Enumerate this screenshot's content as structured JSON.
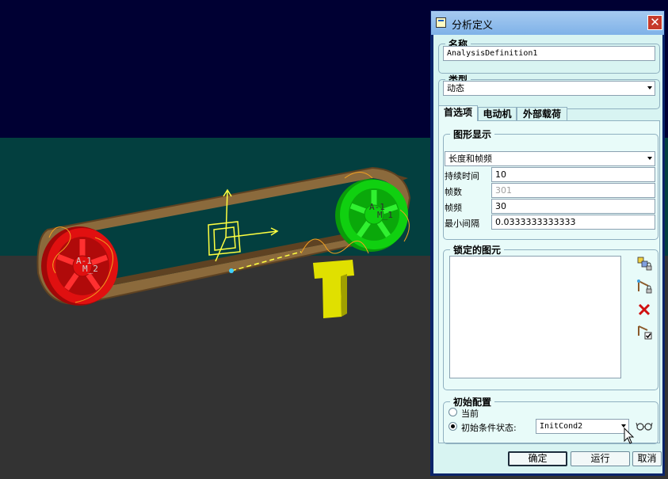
{
  "dialog": {
    "title": "分析定义",
    "name_section": {
      "legend": "名称",
      "value": "AnalysisDefinition1"
    },
    "type_section": {
      "legend": "类型",
      "selected": "动态"
    },
    "tabs": [
      {
        "label": "首选项",
        "active": true
      },
      {
        "label": "电动机",
        "active": false
      },
      {
        "label": "外部载荷",
        "active": false
      }
    ],
    "graphics": {
      "legend": "图形显示",
      "mode": "长度和帧频",
      "rows": [
        {
          "label": "持续时间",
          "value": "10",
          "enabled": true
        },
        {
          "label": "帧数",
          "value": "301",
          "enabled": false
        },
        {
          "label": "帧频",
          "value": "30",
          "enabled": true
        },
        {
          "label": "最小间隔",
          "value": "0.0333333333333",
          "enabled": true
        }
      ]
    },
    "locked": {
      "legend": "锁定的图元",
      "icons": [
        "select-body-lock-icon",
        "select-connection-lock-icon",
        "delete-icon",
        "enable-check-icon"
      ]
    },
    "initial": {
      "legend": "初始配置",
      "option_current": "当前",
      "option_state": "初始条件状态:",
      "selected_option": "初始条件状态:",
      "state_value": "InitCond2"
    },
    "buttons": {
      "ok": "确定",
      "run": "运行",
      "cancel": "取消"
    }
  },
  "model_labels": [
    "A-1",
    "M_2",
    "A-1",
    "M_1"
  ],
  "colors": {
    "background_top": "#000033",
    "wall": "#033f3f",
    "floor": "#333333",
    "belt": "#8b6a3c",
    "left_pulley": "#e01010",
    "right_pulley": "#10d010",
    "post": "#e0e000",
    "dialog_body": "#d8f4f2"
  }
}
